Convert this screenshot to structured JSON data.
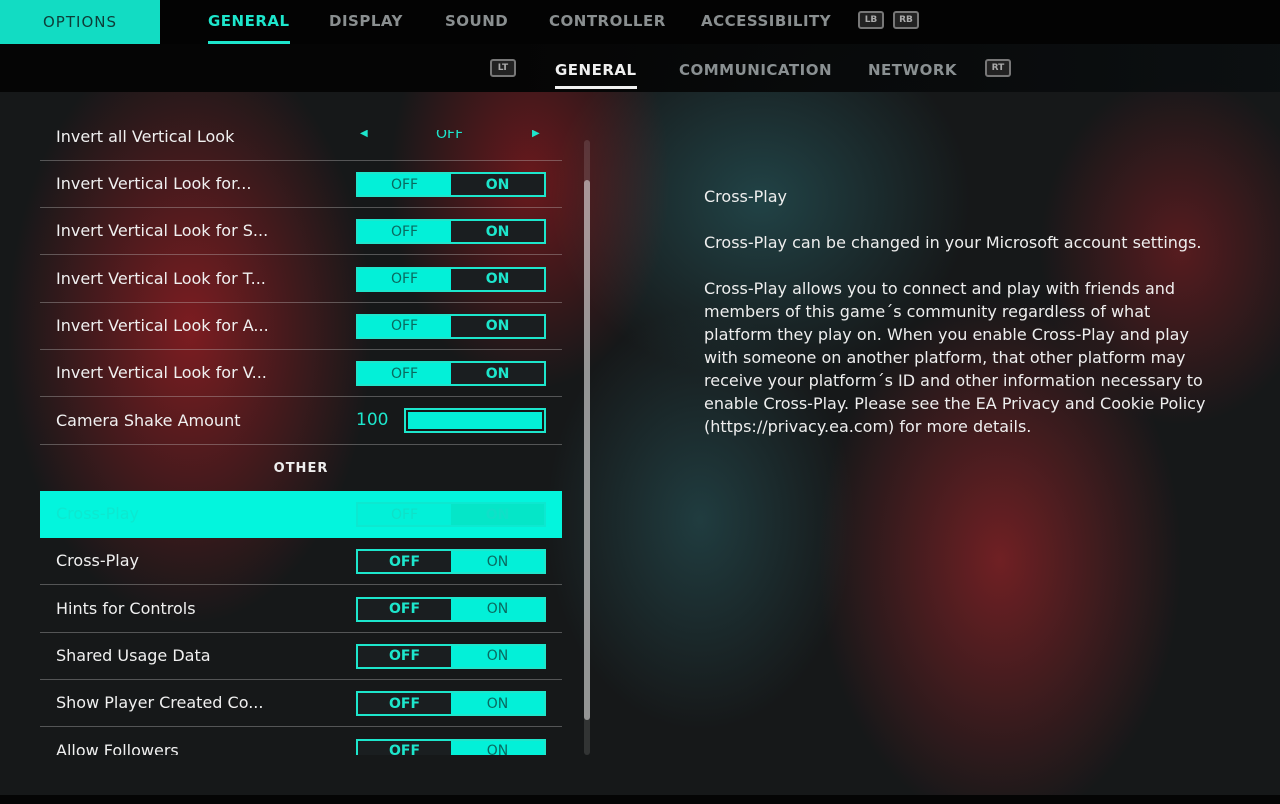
{
  "header": {
    "options_label": "OPTIONS",
    "tabs": [
      {
        "label": "GENERAL",
        "active": true
      },
      {
        "label": "DISPLAY"
      },
      {
        "label": "SOUND"
      },
      {
        "label": "CONTROLLER"
      },
      {
        "label": "ACCESSIBILITY"
      }
    ],
    "lb": "LB",
    "rb": "RB"
  },
  "subheader": {
    "lt": "LT",
    "rt": "RT",
    "tabs": [
      {
        "label": "GENERAL",
        "active": true
      },
      {
        "label": "COMMUNICATION"
      },
      {
        "label": "NETWORK"
      }
    ]
  },
  "settings": {
    "partial_top": {
      "label": "Invert all Vertical Look",
      "value": "OFF"
    },
    "rows": [
      {
        "label": "Invert Vertical Look for...",
        "off": "OFF",
        "on": "ON",
        "selected": "ON"
      },
      {
        "label": "Invert Vertical Look for S...",
        "off": "OFF",
        "on": "ON",
        "selected": "ON"
      },
      {
        "label": "Invert Vertical Look for T...",
        "off": "OFF",
        "on": "ON",
        "selected": "ON"
      },
      {
        "label": "Invert Vertical Look for A...",
        "off": "OFF",
        "on": "ON",
        "selected": "ON"
      },
      {
        "label": "Invert Vertical Look for V...",
        "off": "OFF",
        "on": "ON",
        "selected": "ON"
      }
    ],
    "camera_shake": {
      "label": "Camera Shake Amount",
      "value": "100",
      "percent": 100
    },
    "section_other": "OTHER",
    "other_rows": [
      {
        "label": "Cross-Play",
        "off": "OFF",
        "on": "ON",
        "selected": "ON",
        "highlighted": true
      },
      {
        "label": "Cross-Play",
        "off": "OFF",
        "on": "ON",
        "selected": "OFF"
      },
      {
        "label": "Hints for Controls",
        "off": "OFF",
        "on": "ON",
        "selected": "OFF"
      },
      {
        "label": "Shared Usage Data",
        "off": "OFF",
        "on": "ON",
        "selected": "OFF"
      },
      {
        "label": "Show Player Created Co...",
        "off": "OFF",
        "on": "ON",
        "selected": "OFF"
      },
      {
        "label": "Allow Followers",
        "off": "OFF",
        "on": "ON",
        "selected": "OFF"
      }
    ]
  },
  "description": {
    "title": "Cross-Play",
    "p1": "Cross-Play can be changed in your Microsoft account settings.",
    "p2": "Cross-Play allows you to connect and play with friends and members of this game´s community regardless of what platform they play on. When you enable Cross-Play and play with someone on another platform, that other platform may receive your platform´s ID and other information necessary to enable Cross-Play. Please see the EA Privacy and Cookie Policy (https://privacy.ea.com) for more details."
  },
  "colors": {
    "accent": "#03f0d8"
  }
}
